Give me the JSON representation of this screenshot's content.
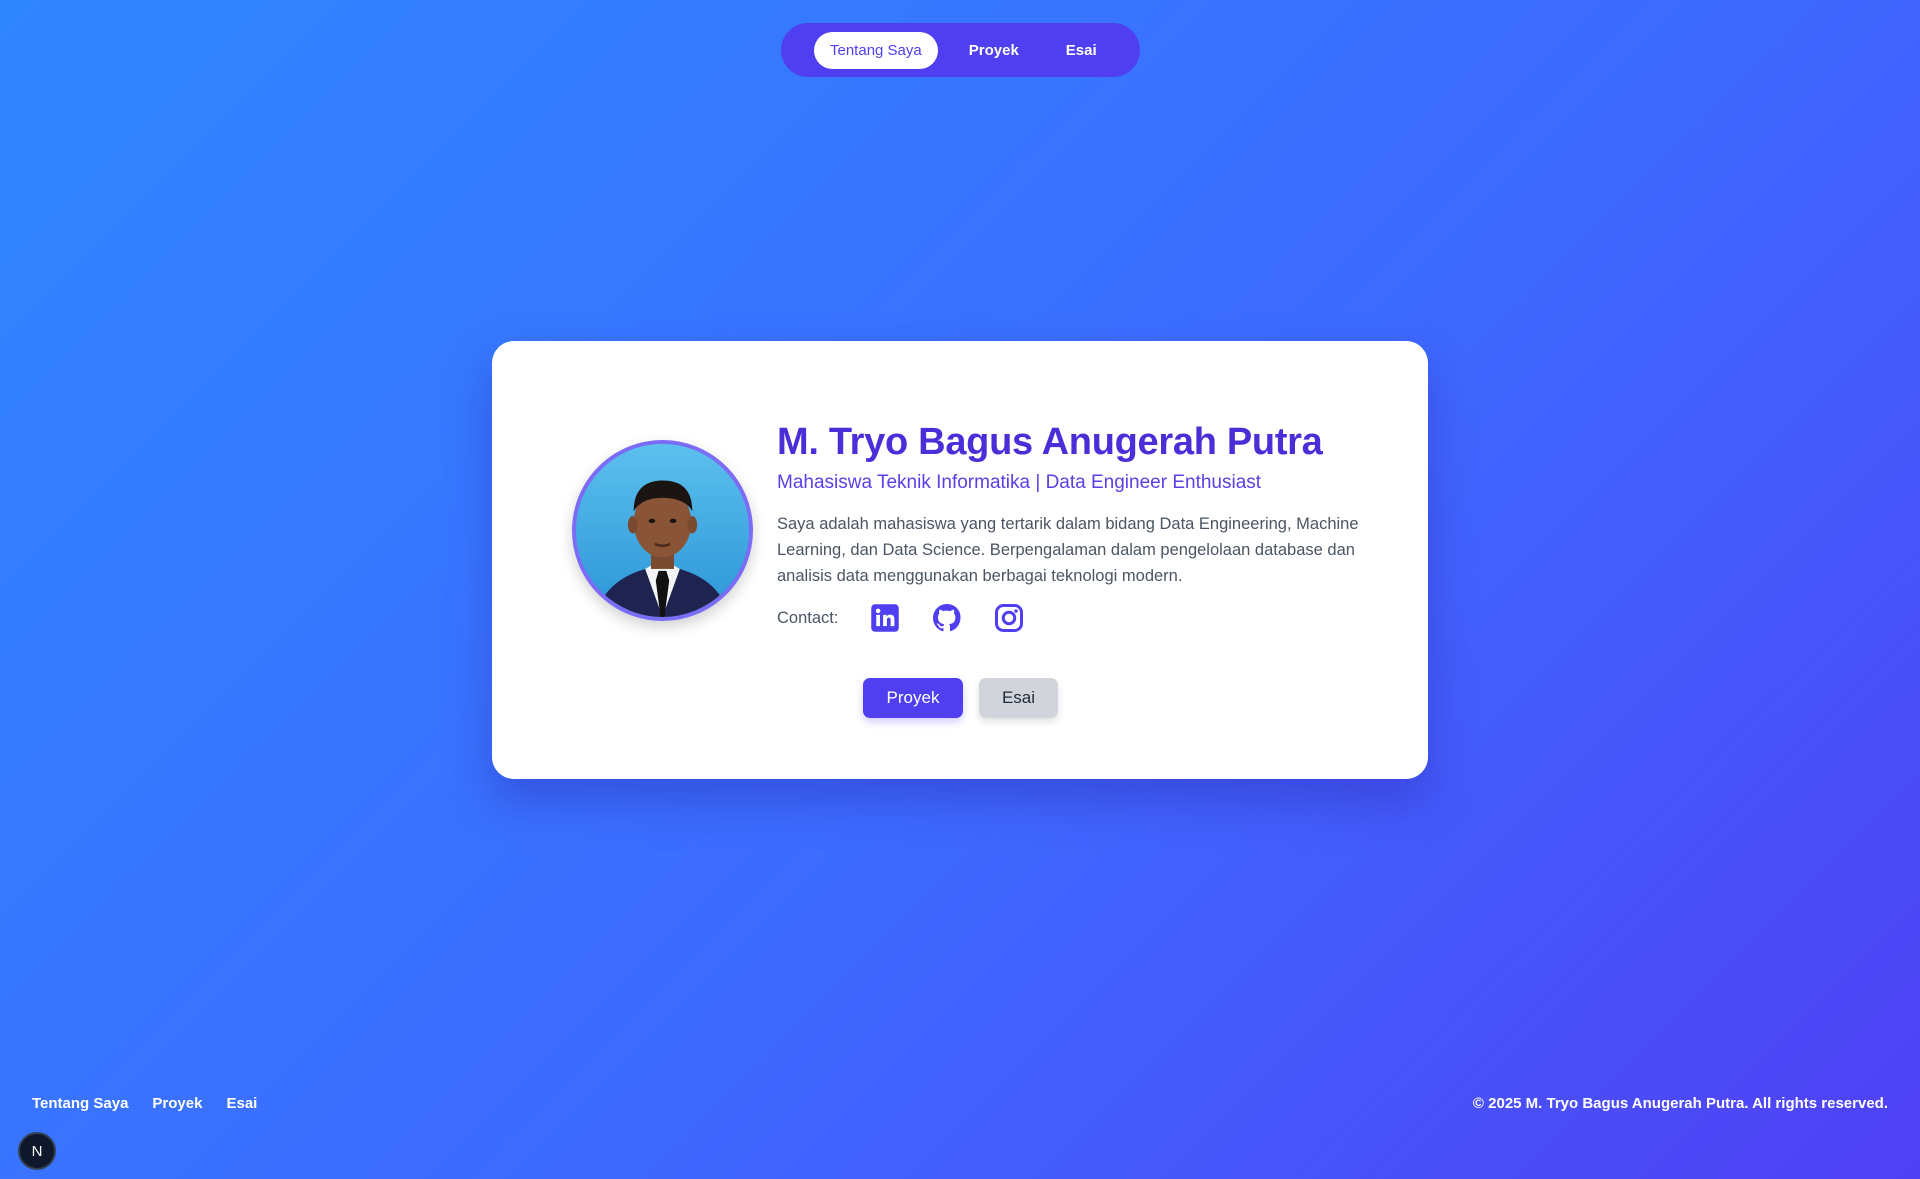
{
  "nav": {
    "items": [
      {
        "label": "Tentang Saya",
        "active": true
      },
      {
        "label": "Proyek",
        "active": false
      },
      {
        "label": "Esai",
        "active": false
      }
    ]
  },
  "profile": {
    "name": "M. Tryo Bagus Anugerah Putra",
    "tagline": "Mahasiswa Teknik Informatika | Data Engineer Enthusiast",
    "bio": "Saya adalah mahasiswa yang tertarik dalam bidang Data Engineering, Machine Learning, dan Data Science. Berpengalaman dalam pengelolaan database dan analisis data menggunakan berbagai teknologi modern.",
    "contact_label": "Contact:",
    "socials": [
      "linkedin-icon",
      "github-icon",
      "instagram-icon"
    ]
  },
  "actions": {
    "primary_label": "Proyek",
    "secondary_label": "Esai"
  },
  "footer": {
    "links": [
      "Tentang Saya",
      "Proyek",
      "Esai"
    ],
    "copyright": "© 2025 M. Tryo Bagus Anugerah Putra. All rights reserved.",
    "badge_letter": "N"
  },
  "colors": {
    "accent": "#4f3ff0",
    "name_color": "#4a2fd8",
    "bg_start": "#2f86ff",
    "bg_end": "#5040f5"
  }
}
